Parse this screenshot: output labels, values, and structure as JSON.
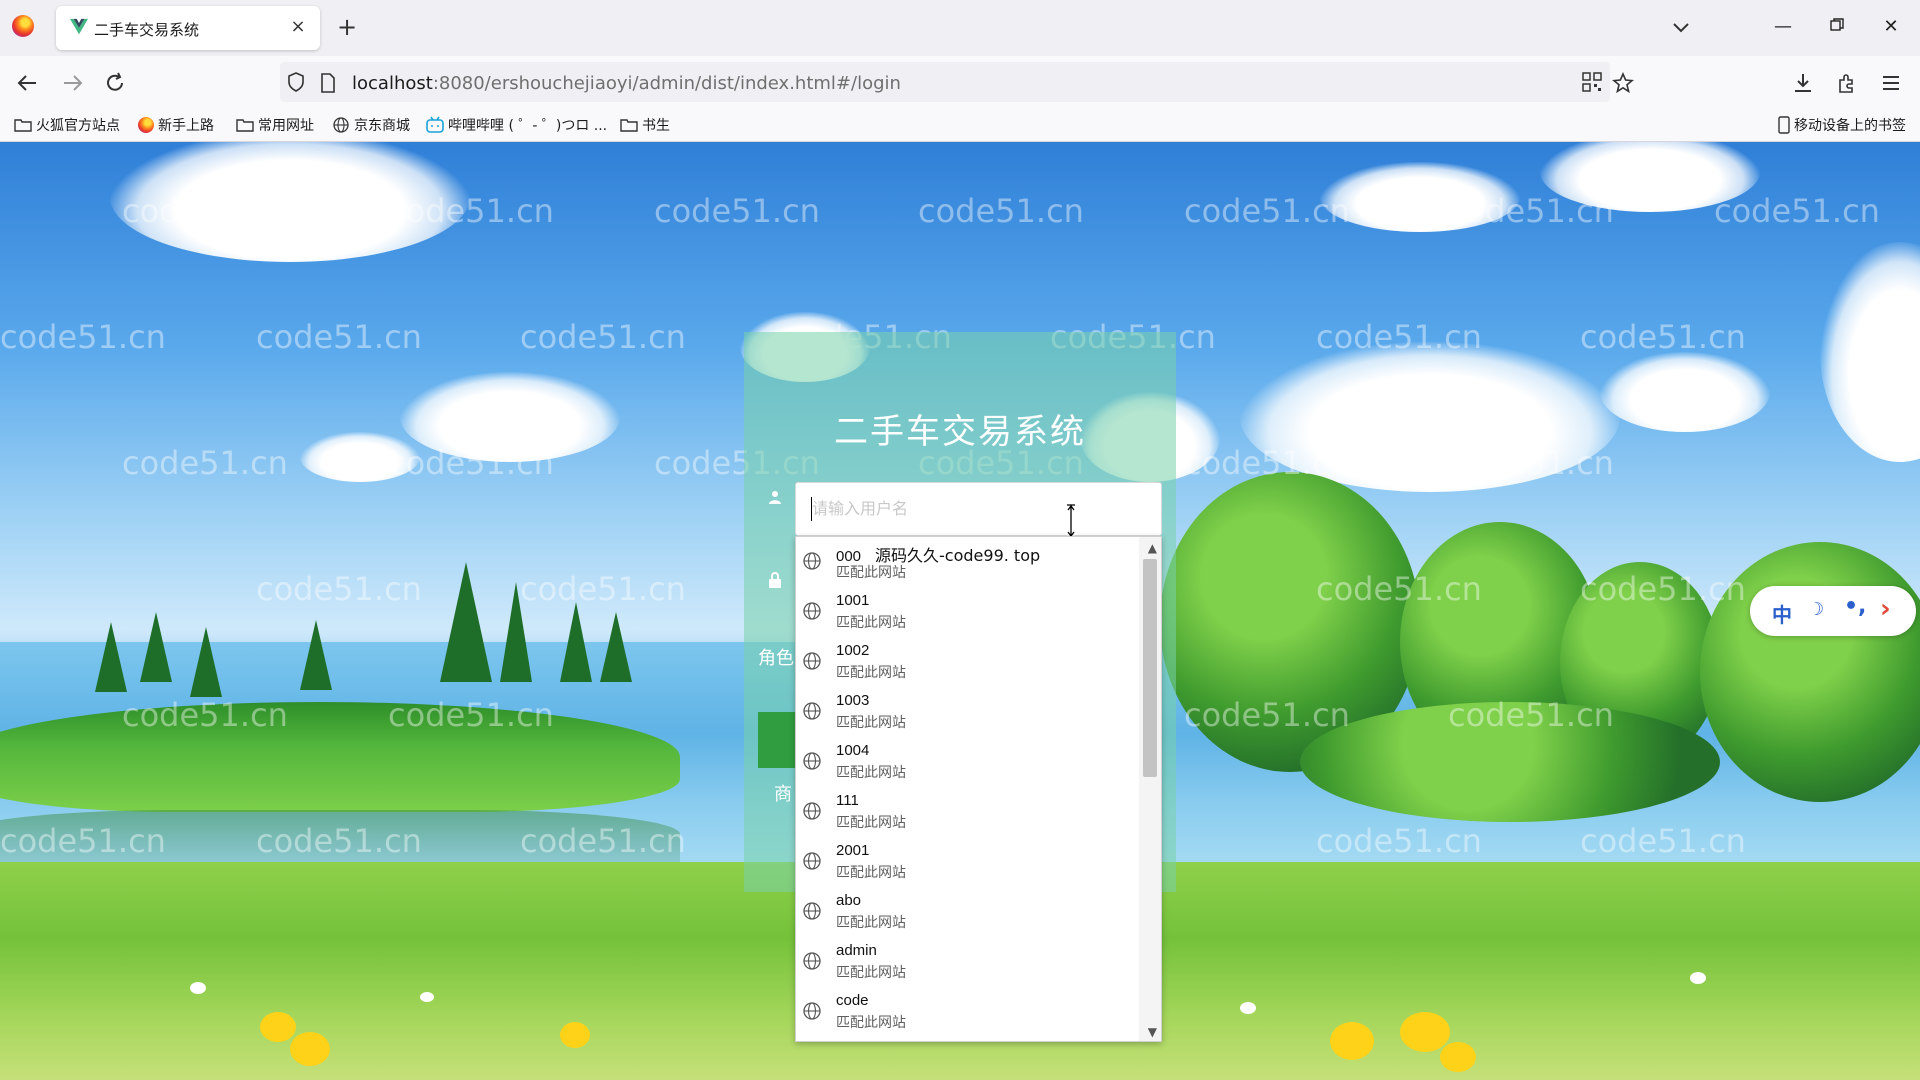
{
  "browser": {
    "tab_title": "二手车交易系统",
    "new_tab": "+",
    "url_host": "localhost",
    "url_rest": ":8080/ershouchejiaoyi/admin/dist/index.html#/login",
    "bookmarks": [
      "火狐官方站点",
      "新手上路",
      "常用网址",
      "京东商城",
      "哔哩哔哩 ( ゜- ゜)つロ ...",
      "书生"
    ],
    "mobile_bookmarks": "移动设备上的书签"
  },
  "page": {
    "title": "二手车交易系统",
    "username_placeholder": "请输入用户名",
    "role_label": "角色",
    "shop_label": "商",
    "watermark": "code51.cn"
  },
  "autocomplete": {
    "items": [
      {
        "value": "000",
        "extra": "源码久久-code99. top",
        "sub": "匹配此网站"
      },
      {
        "value": "1001",
        "sub": "匹配此网站"
      },
      {
        "value": "1002",
        "sub": "匹配此网站"
      },
      {
        "value": "1003",
        "sub": "匹配此网站"
      },
      {
        "value": "1004",
        "sub": "匹配此网站"
      },
      {
        "value": "111",
        "sub": "匹配此网站"
      },
      {
        "value": "2001",
        "sub": "匹配此网站"
      },
      {
        "value": "abo",
        "sub": "匹配此网站"
      },
      {
        "value": "admin",
        "sub": "匹配此网站"
      },
      {
        "value": "code",
        "sub": "匹配此网站"
      }
    ]
  },
  "widget": {
    "zh": "中",
    "moon": "☽",
    "quote": "•,",
    "arrow": "›"
  },
  "colors": {
    "panel": "#78d2aa",
    "widget_accent": "#2a5fcc",
    "widget_arrow": "#e04a3a"
  }
}
